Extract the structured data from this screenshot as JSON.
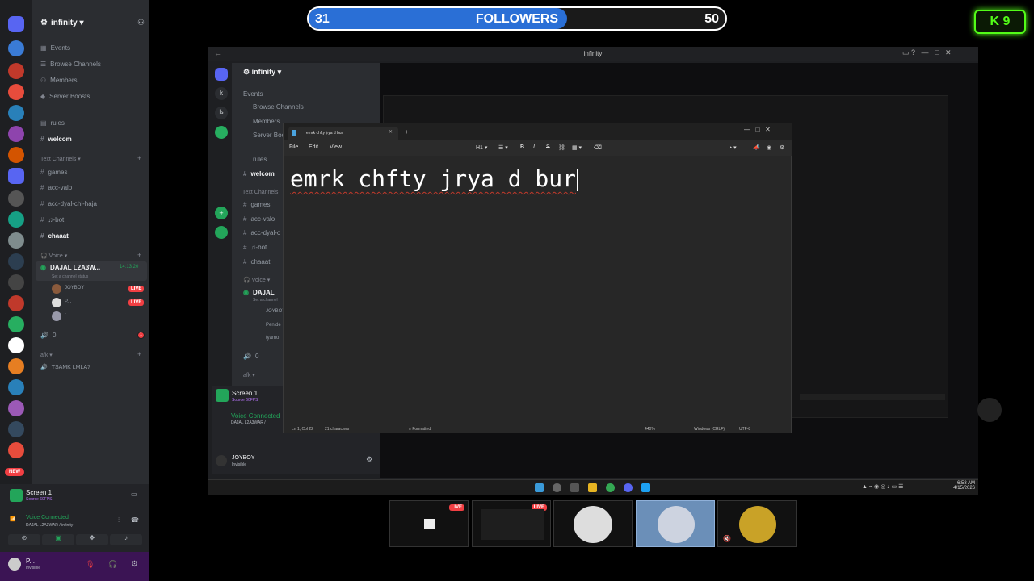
{
  "followers": {
    "current": "31",
    "label": "FOLLOWERS",
    "goal": "50",
    "progress": 0.62
  },
  "kick_badge": "K 9",
  "rail": {
    "badges": [
      "21",
      "57",
      "4",
      "33",
      "8",
      "1",
      "1",
      "1K+",
      "324",
      "1",
      "NEW"
    ]
  },
  "sidebar": {
    "server_name": "infinity",
    "items": [
      {
        "label": "Events"
      },
      {
        "label": "Browse Channels"
      },
      {
        "label": "Members"
      },
      {
        "label": "Server Boosts"
      }
    ],
    "channels_top": [
      {
        "label": "rules",
        "bold": false
      },
      {
        "label": "welcom",
        "bold": true
      }
    ],
    "text_category": "Text Channels",
    "text_channels": [
      {
        "label": "games",
        "bold": false
      },
      {
        "label": "acc-valo",
        "bold": false
      },
      {
        "label": "acc-dyal-chi-haja",
        "bold": false
      },
      {
        "label": "♫-bot",
        "bold": false
      },
      {
        "label": "chaaat",
        "bold": true
      }
    ],
    "voice_category": "Voice",
    "voice_channel": {
      "label": "DAJAL L2A3W...",
      "time": "14:13:20",
      "status": "Set a channel status"
    },
    "voice_users": [
      {
        "name": "JOYBOY",
        "live": "LIVE"
      },
      {
        "name": "P...",
        "live": "LIVE"
      },
      {
        "name": "t...",
        "live": ""
      }
    ],
    "channel_zero": "0",
    "channel_zero_badge": "1",
    "afk_category": "afk",
    "afk_channel": "TSAMK LMLA7"
  },
  "user_panel": {
    "screen_title": "Screen 1",
    "screen_sub": "Source 60FPS",
    "voice_connected": "Voice Connected",
    "voice_path": "DAJAL L2A3WAR / infinity",
    "username": "P...",
    "user_status": "Invisible"
  },
  "stream": {
    "window_title": "infinity",
    "server_name": "infinity",
    "items": [
      "Events",
      "Browse Channels",
      "Members",
      "Server Boo"
    ],
    "channels": [
      "rules",
      "welcom"
    ],
    "text_category": "Text Channels",
    "text_channels": [
      "games",
      "acc-valo",
      "acc-dyal-c",
      "♫-bot",
      "chaaat"
    ],
    "voice_category": "Voice",
    "voice_channel": "DAJAL",
    "voice_status": "Set a channel",
    "voice_users": [
      "JOYBOY",
      "Penide",
      "tyamo"
    ],
    "zero": "0",
    "afk": "afk",
    "screen_title": "Screen 1",
    "screen_sub": "Source 60FPS",
    "voice_connected": "Voice Connected",
    "voice_path": "DAJAL L2A3WAR / i",
    "username": "JOYBOY",
    "user_status": "Invisible",
    "clock_time": "6:58 AM",
    "clock_date": "4/15/2026"
  },
  "notepad": {
    "tab_title": "emrk chfty jrya d bur",
    "menu": [
      "File",
      "Edit",
      "View"
    ],
    "heading": "H1",
    "text": "emrk chfty jrya d bur",
    "status_pos": "Ln 1, Col 22",
    "status_chars": "21 characters",
    "status_format": "Formatted",
    "status_zoom": "440%",
    "status_eol": "Windows (CRLF)",
    "status_enc": "UTF-8"
  },
  "thumbnails": [
    {
      "live": "LIVE"
    },
    {
      "live": "LIVE"
    },
    {
      "live": ""
    },
    {
      "live": ""
    },
    {
      "live": ""
    }
  ]
}
